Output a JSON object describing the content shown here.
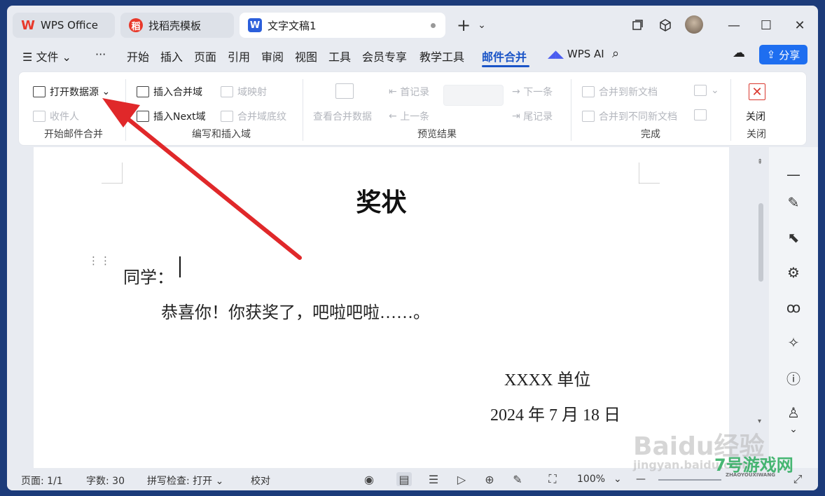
{
  "titlebar": {
    "tabs": [
      {
        "label": "WPS Office",
        "icon": "wps-logo-icon",
        "color": "#e8392b"
      },
      {
        "label": "找稻壳模板",
        "icon": "docer-logo-icon",
        "color": "#e8392b"
      },
      {
        "label": "文字文稿1",
        "icon": "wps-writer-icon",
        "color": "#2b5fdb"
      }
    ],
    "new_tab_symbol": "+",
    "dropdown_symbol": "⌄",
    "window_controls": {
      "minimize": "—",
      "maximize": "☐",
      "close": "✕"
    }
  },
  "menubar": {
    "file_label": "文件",
    "more_label": "···",
    "items": [
      "开始",
      "插入",
      "页面",
      "引用",
      "审阅",
      "视图",
      "工具",
      "会员专享",
      "教学工具",
      "邮件合并"
    ],
    "active_item": "邮件合并",
    "ai_label": "WPS AI",
    "share_label": "分享",
    "accent": "#1a54c7"
  },
  "ribbon": {
    "start_group": {
      "open_source": "打开数据源",
      "recipients": "收件人",
      "label": "开始邮件合并"
    },
    "insert_group": {
      "insert_field": "插入合并域",
      "map_fields": "域映射",
      "insert_next": "插入Next域",
      "shading": "合并域底纹",
      "label": "编写和插入域"
    },
    "preview_group": {
      "view_data": "查看合并数据",
      "first": "首记录",
      "prev": "上一条",
      "next": "下一条",
      "last": "尾记录",
      "label": "预览结果"
    },
    "finish_group": {
      "to_new_doc": "合并到新文档",
      "to_separate": "合并到不同新文档",
      "label": "完成"
    },
    "close_group": {
      "close": "关闭",
      "label": "关闭"
    }
  },
  "document": {
    "title": "奖状",
    "salutation": "同学：",
    "body": "恭喜你！你获奖了，吧啦吧啦……。",
    "org": "XXXX 单位",
    "date": "2024 年 7 月 18 日"
  },
  "status": {
    "page": "页面: 1/1",
    "words": "字数: 30",
    "spell": "拼写检查: 打开",
    "proof": "校对",
    "zoom": "100%"
  },
  "watermarks": {
    "baidu": "Baidu经验",
    "baidu_url": "jingyan.baidu.com",
    "game": "7号游戏网",
    "game_sub": "ZHAOYOUXIWANG"
  },
  "annotation": {
    "arrow_color": "#e0282a"
  }
}
